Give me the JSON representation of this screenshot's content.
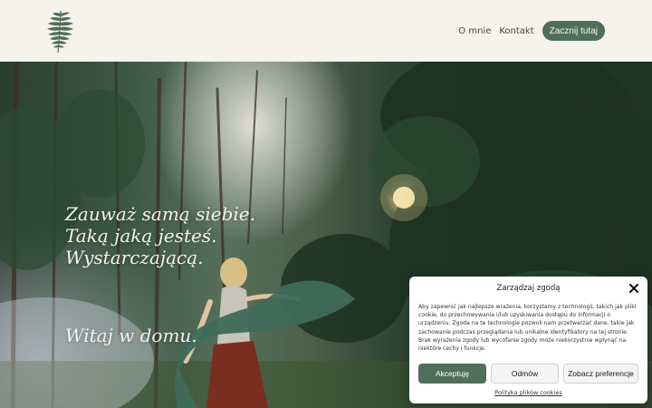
{
  "header": {
    "logo_icon": "fern-leaf-icon",
    "nav": [
      {
        "label": "O mnie"
      },
      {
        "label": "Kontakt"
      }
    ],
    "cta_label": "Zacznij tutaj"
  },
  "hero": {
    "tagline": [
      "Zauważ samą siebie.",
      "Taką jaką jesteś.",
      "Wystarczającą."
    ],
    "welcome": "Witaj w domu."
  },
  "cookie": {
    "title": "Zarządzaj zgodą",
    "close_icon": "close-icon",
    "text": "Aby zapewnić jak najlepsze wrażenia, korzystamy z technologii, takich jak pliki cookie, do przechowywania i/lub uzyskiwania dostępu do informacji o urządzeniu. Zgoda na te technologie pozwoli nam przetwarzać dane, takie jak zachowanie podczas przeglądania lub unikalne identyfikatory na tej stronie. Brak wyrażenia zgody lub wycofanie zgody może niekorzystnie wpłynąć na niektóre cechy i funkcje.",
    "accept_label": "Akceptuję",
    "deny_label": "Odmów",
    "prefs_label": "Zobacz preferencje",
    "policy_label": "Polityka plików cookies"
  },
  "colors": {
    "accent": "#4f6f59",
    "header_bg": "#f6f2ec"
  }
}
